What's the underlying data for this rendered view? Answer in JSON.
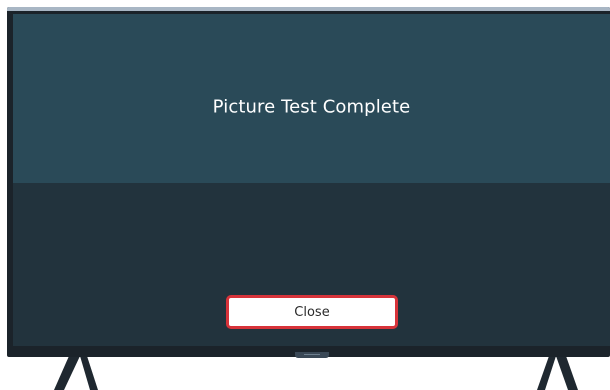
{
  "dialog": {
    "title": "Picture Test Complete",
    "close_label": "Close"
  },
  "colors": {
    "bezel": "#1b232a",
    "banner": "#2a4a58",
    "screen_bottom": "#22333d",
    "focus_border": "#d7333a"
  }
}
